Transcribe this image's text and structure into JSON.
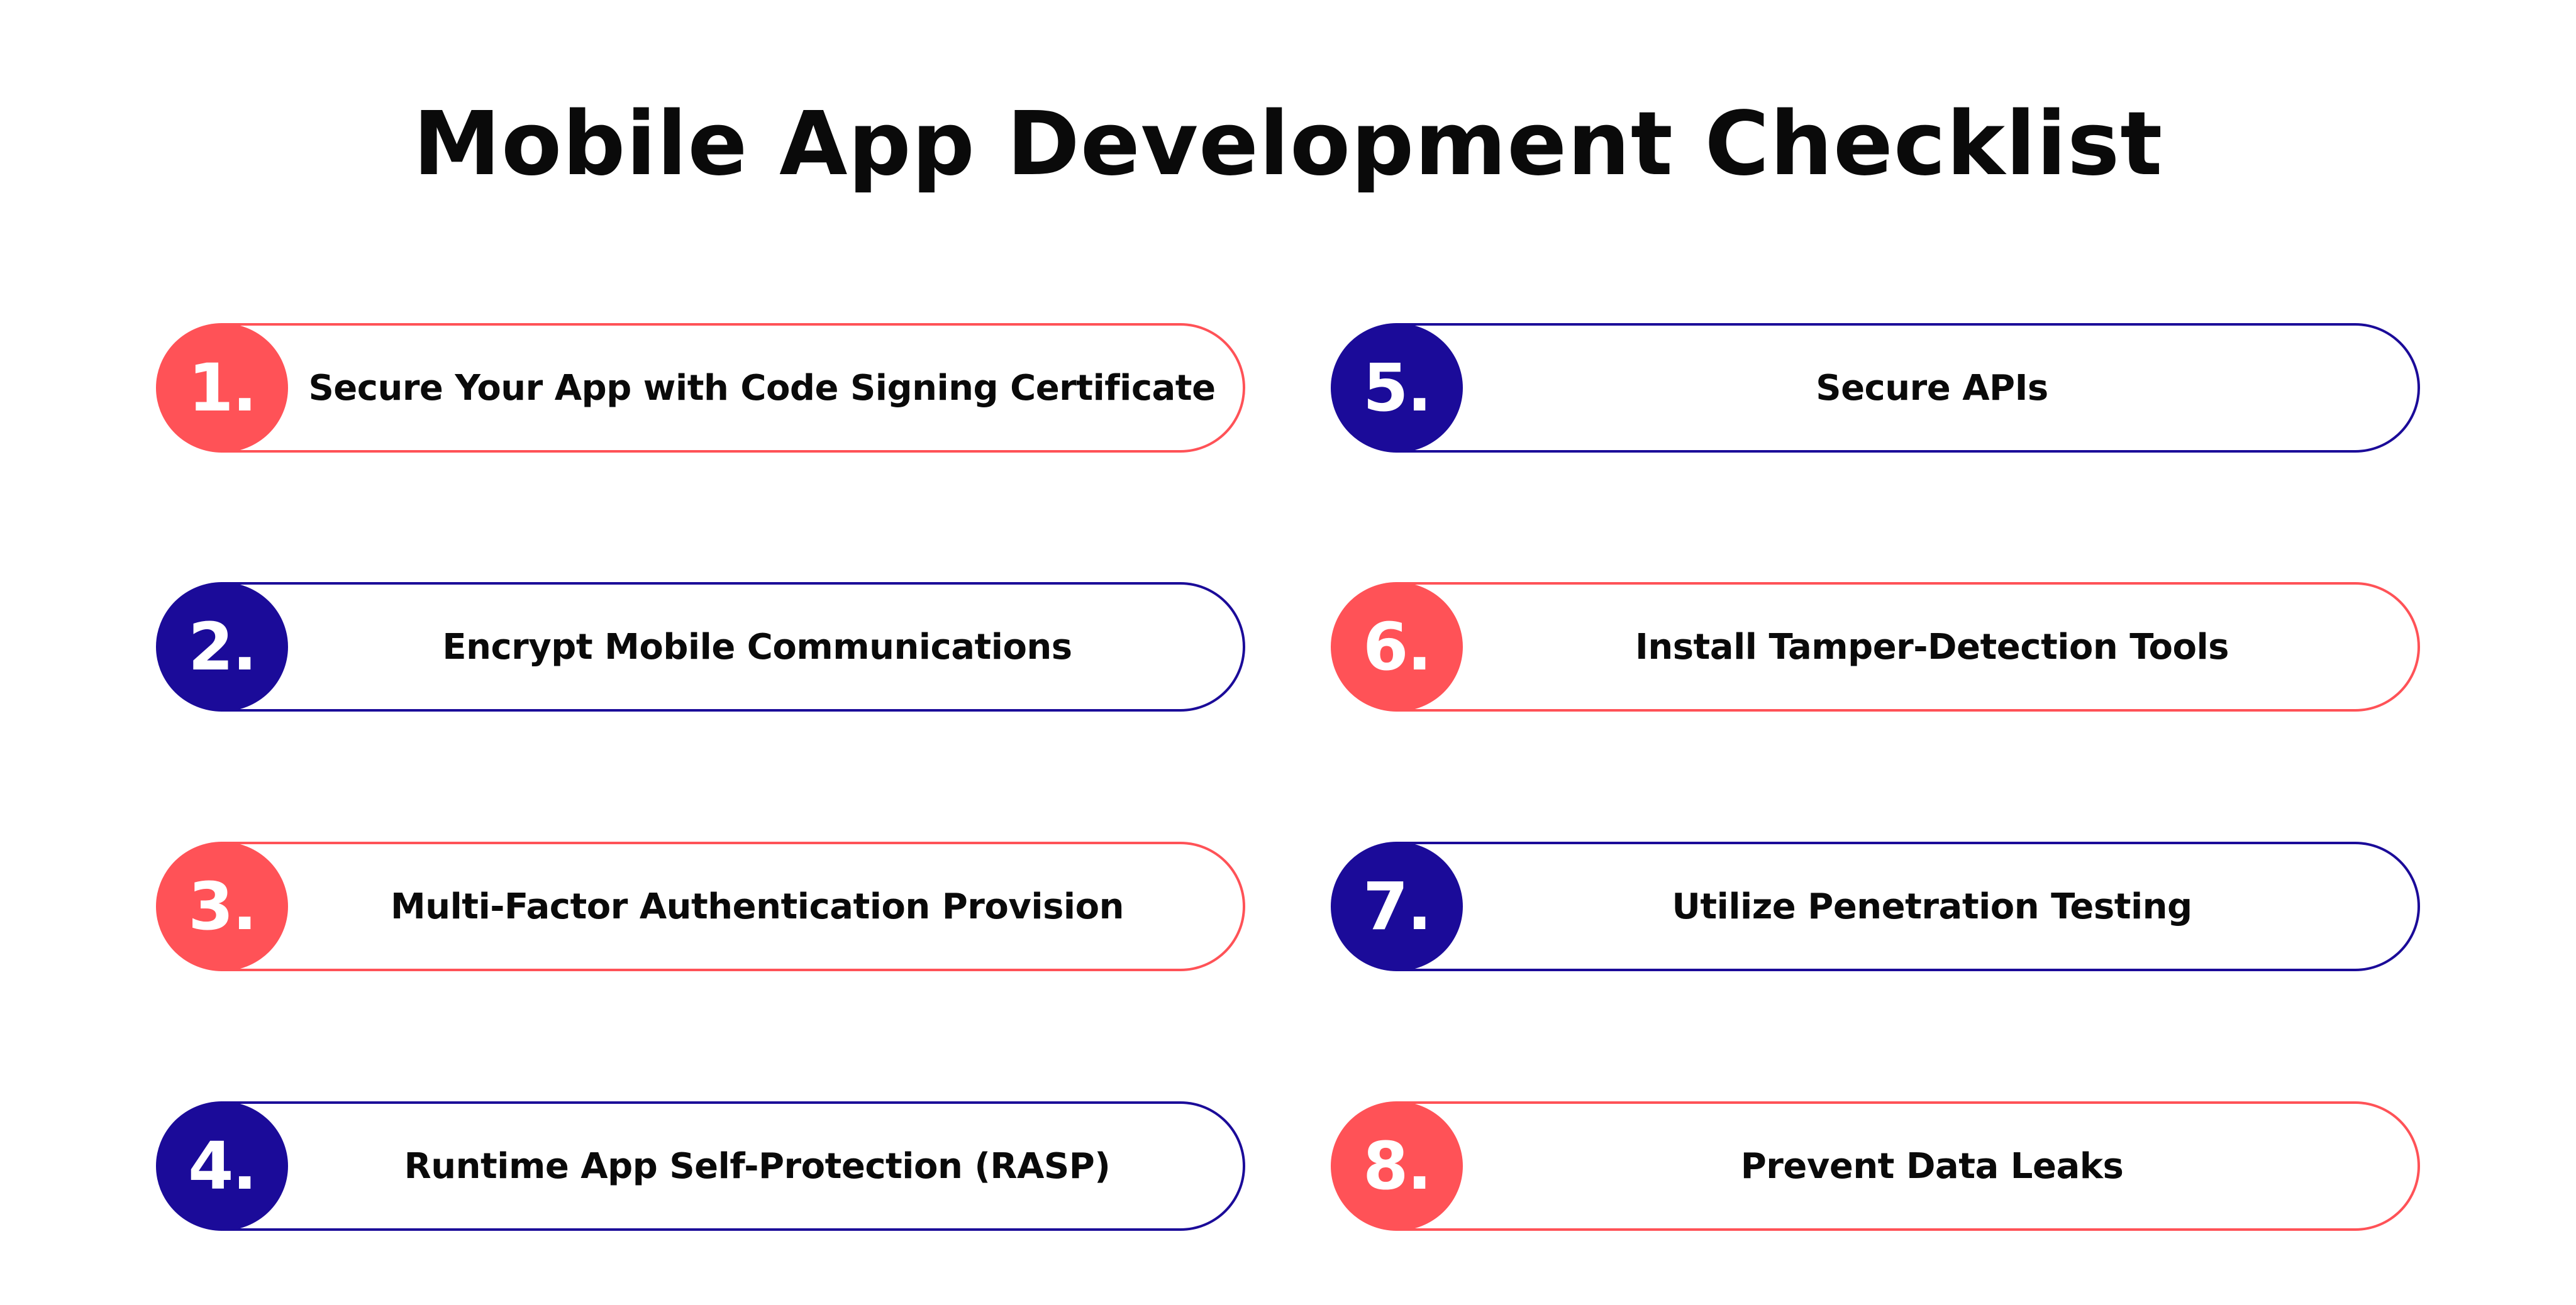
{
  "title": "Mobile App Development Checklist",
  "colors": {
    "red": "#FF5257",
    "navy": "#1B0B99",
    "text": "#0A0A0A"
  },
  "items": [
    {
      "number": "1.",
      "label": "Secure Your App with Code Signing Certificate",
      "color": "red"
    },
    {
      "number": "2.",
      "label": "Encrypt Mobile Communications",
      "color": "navy"
    },
    {
      "number": "3.",
      "label": "Multi-Factor Authentication Provision",
      "color": "red"
    },
    {
      "number": "4.",
      "label": "Runtime App Self-Protection (RASP)",
      "color": "navy"
    },
    {
      "number": "5.",
      "label": "Secure APIs",
      "color": "navy"
    },
    {
      "number": "6.",
      "label": "Install Tamper-Detection Tools",
      "color": "red"
    },
    {
      "number": "7.",
      "label": "Utilize Penetration Testing",
      "color": "navy"
    },
    {
      "number": "8.",
      "label": "Prevent Data Leaks",
      "color": "red"
    }
  ]
}
